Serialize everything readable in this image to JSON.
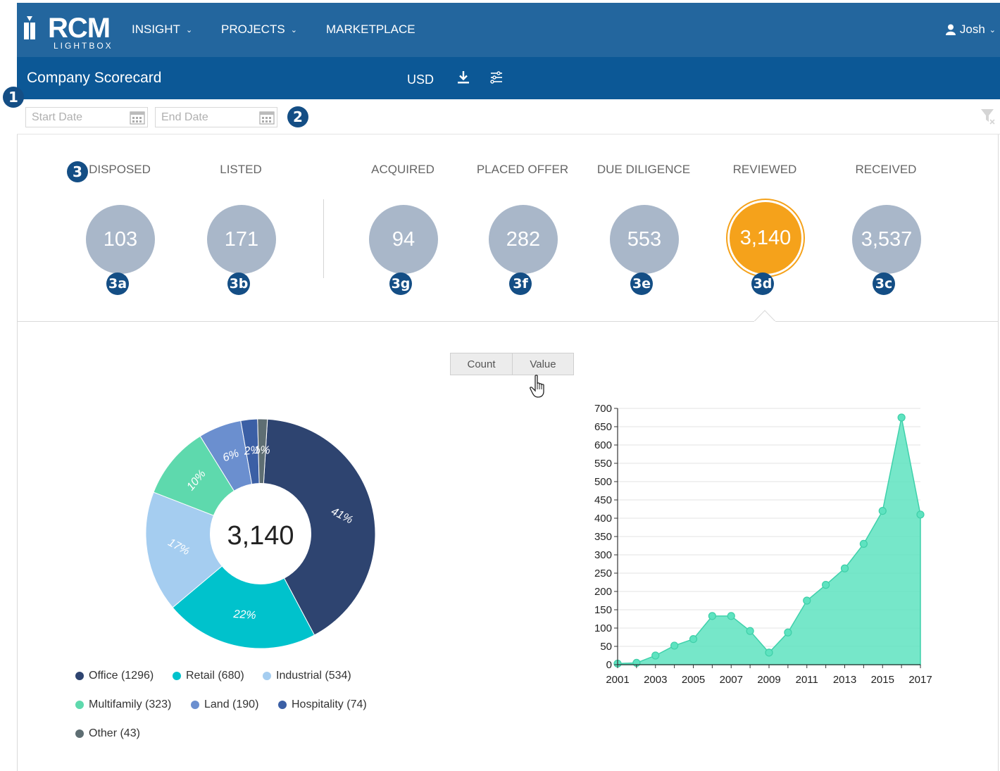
{
  "nav": {
    "logo_text": "RCM",
    "logo_sub": "LIGHTBOX",
    "items": [
      {
        "label": "INSIGHT",
        "has_dropdown": true
      },
      {
        "label": "PROJECTS",
        "has_dropdown": true
      },
      {
        "label": "MARKETPLACE",
        "has_dropdown": false
      }
    ],
    "user": "Josh"
  },
  "header": {
    "title": "Company Scorecard",
    "currency": "USD",
    "icons": [
      "download-icon",
      "settings-sliders-icon"
    ]
  },
  "filters": {
    "start_placeholder": "Start Date",
    "end_placeholder": "End Date"
  },
  "callouts": {
    "one": "1",
    "two": "2",
    "three": "3"
  },
  "stages": [
    {
      "label": "DISPOSED",
      "value": "103",
      "badge": "3a"
    },
    {
      "label": "LISTED",
      "value": "171",
      "badge": "3b"
    },
    {
      "label": "ACQUIRED",
      "value": "94",
      "badge": "3g"
    },
    {
      "label": "PLACED OFFER",
      "value": "282",
      "badge": "3f"
    },
    {
      "label": "DUE DILIGENCE",
      "value": "553",
      "badge": "3e"
    },
    {
      "label": "REVIEWED",
      "value": "3,140",
      "badge": "3d",
      "active": true
    },
    {
      "label": "RECEIVED",
      "value": "3,537",
      "badge": "3c"
    }
  ],
  "toggle": {
    "count": "Count",
    "value": "Value"
  },
  "colors": {
    "nav": "#23669e",
    "subheader": "#0c5896",
    "badge": "#144e85",
    "stage_inactive": "#a9b7c9",
    "stage_active": "#f5a21b",
    "area": "#5ee3c0"
  },
  "chart_data": [
    {
      "type": "pie",
      "center_label": "3,140",
      "slices": [
        {
          "name": "Office",
          "count": 1296,
          "pct_label": "41%",
          "legend": "Office (1296)",
          "color": "#2e4470"
        },
        {
          "name": "Retail",
          "count": 680,
          "pct_label": "22%",
          "legend": "Retail (680)",
          "color": "#00c2cc"
        },
        {
          "name": "Industrial",
          "count": 534,
          "pct_label": "17%",
          "legend": "Industrial (534)",
          "color": "#a5cdf0"
        },
        {
          "name": "Multifamily",
          "count": 323,
          "pct_label": "10%",
          "legend": "Multifamily (323)",
          "color": "#5ed9ad"
        },
        {
          "name": "Land",
          "count": 190,
          "pct_label": "6%",
          "legend": "Land (190)",
          "color": "#6b8fcf"
        },
        {
          "name": "Hospitality",
          "count": 74,
          "pct_label": "2%",
          "legend": "Hospitality (74)",
          "color": "#3b5fa5"
        },
        {
          "name": "Other",
          "count": 43,
          "pct_label": "1%",
          "legend": "Other (43)",
          "color": "#5e6e73"
        }
      ]
    },
    {
      "type": "area",
      "x": [
        2001,
        2002,
        2003,
        2004,
        2005,
        2006,
        2007,
        2008,
        2009,
        2010,
        2011,
        2012,
        2013,
        2014,
        2015,
        2016,
        2017
      ],
      "y": [
        3,
        5,
        25,
        52,
        70,
        133,
        133,
        92,
        33,
        88,
        175,
        218,
        263,
        330,
        420,
        675,
        410
      ],
      "xticks": [
        "2001",
        "2003",
        "2005",
        "2007",
        "2009",
        "2011",
        "2013",
        "2015",
        "2017"
      ],
      "yticks": [
        "0",
        "50",
        "100",
        "150",
        "200",
        "250",
        "300",
        "350",
        "400",
        "450",
        "500",
        "550",
        "600",
        "650",
        "700"
      ],
      "ylim": [
        0,
        700
      ],
      "grid": true
    }
  ]
}
